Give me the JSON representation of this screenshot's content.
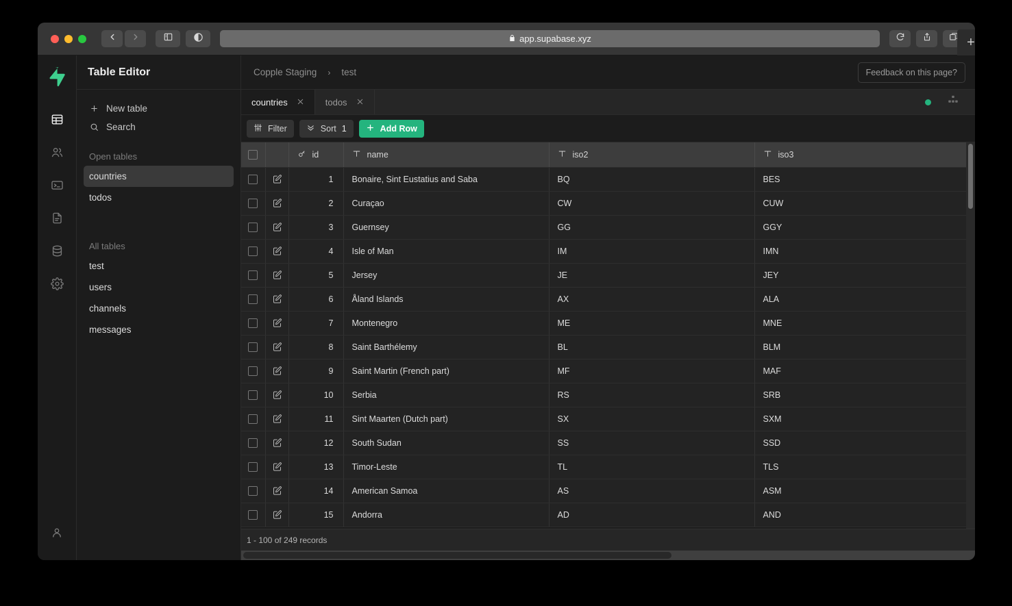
{
  "browser": {
    "url": "app.supabase.xyz",
    "lock_icon": "lock-icon",
    "back_icon": "back-arrow-icon",
    "forward_icon": "forward-arrow-icon",
    "sidebar_toggle_icon": "sidebar-toggle-icon",
    "reader_icon": "reader-mode-icon",
    "reload_icon": "reload-icon",
    "share_icon": "share-icon",
    "tabs_icon": "tab-overview-icon",
    "new_tab_label": "+"
  },
  "rail": {
    "logo_icon": "supabase-logo-icon",
    "items": [
      {
        "name": "table-editor",
        "icon": "table-icon",
        "active": true
      },
      {
        "name": "authentication",
        "icon": "users-icon",
        "active": false
      },
      {
        "name": "sql-editor",
        "icon": "terminal-icon",
        "active": false
      },
      {
        "name": "documentation",
        "icon": "file-icon",
        "active": false
      },
      {
        "name": "database",
        "icon": "database-icon",
        "active": false
      },
      {
        "name": "settings",
        "icon": "gear-icon",
        "active": false
      }
    ],
    "account_icon": "user-account-icon"
  },
  "panel": {
    "title": "Table Editor",
    "new_table_label": "New table",
    "new_table_icon": "plus-icon",
    "search_label": "Search",
    "search_icon": "search-icon",
    "open_tables_label": "Open tables",
    "open_tables": [
      {
        "label": "countries",
        "selected": true
      },
      {
        "label": "todos",
        "selected": false
      }
    ],
    "all_tables_label": "All tables",
    "all_tables": [
      {
        "label": "test"
      },
      {
        "label": "users"
      },
      {
        "label": "channels"
      },
      {
        "label": "messages"
      }
    ]
  },
  "topbar": {
    "breadcrumb_project": "Copple Staging",
    "breadcrumb_sep": "›",
    "breadcrumb_db": "test",
    "feedback_label": "Feedback on this page?"
  },
  "tabs": {
    "items": [
      {
        "label": "countries",
        "active": true,
        "close_icon": "close-icon"
      },
      {
        "label": "todos",
        "active": false,
        "close_icon": "close-icon"
      }
    ],
    "status_dot_color": "#24b47e",
    "schema_icon": "schema-visualizer-icon"
  },
  "toolbar": {
    "filter_label": "Filter",
    "filter_icon": "filter-sliders-icon",
    "sort_label": "Sort",
    "sort_icon": "sort-chevrons-icon",
    "sort_count": "1",
    "add_row_label": "Add Row",
    "add_row_icon": "plus-icon",
    "accent_color": "#24b47e"
  },
  "table": {
    "columns": [
      {
        "key": "id",
        "label": "id",
        "type_icon": "key-icon"
      },
      {
        "key": "name",
        "label": "name",
        "type_icon": "text-type-icon"
      },
      {
        "key": "iso2",
        "label": "iso2",
        "type_icon": "text-type-icon"
      },
      {
        "key": "iso3",
        "label": "iso3",
        "type_icon": "text-type-icon"
      }
    ],
    "select_all_icon": "checkbox-icon",
    "row_edit_icon": "edit-row-icon",
    "rows": [
      {
        "id": "1",
        "name": "Bonaire, Sint Eustatius and Saba",
        "iso2": "BQ",
        "iso3": "BES"
      },
      {
        "id": "2",
        "name": "Curaçao",
        "iso2": "CW",
        "iso3": "CUW"
      },
      {
        "id": "3",
        "name": "Guernsey",
        "iso2": "GG",
        "iso3": "GGY"
      },
      {
        "id": "4",
        "name": "Isle of Man",
        "iso2": "IM",
        "iso3": "IMN"
      },
      {
        "id": "5",
        "name": "Jersey",
        "iso2": "JE",
        "iso3": "JEY"
      },
      {
        "id": "6",
        "name": "Åland Islands",
        "iso2": "AX",
        "iso3": "ALA"
      },
      {
        "id": "7",
        "name": "Montenegro",
        "iso2": "ME",
        "iso3": "MNE"
      },
      {
        "id": "8",
        "name": "Saint Barthélemy",
        "iso2": "BL",
        "iso3": "BLM"
      },
      {
        "id": "9",
        "name": "Saint Martin (French part)",
        "iso2": "MF",
        "iso3": "MAF"
      },
      {
        "id": "10",
        "name": "Serbia",
        "iso2": "RS",
        "iso3": "SRB"
      },
      {
        "id": "11",
        "name": "Sint Maarten (Dutch part)",
        "iso2": "SX",
        "iso3": "SXM"
      },
      {
        "id": "12",
        "name": "South Sudan",
        "iso2": "SS",
        "iso3": "SSD"
      },
      {
        "id": "13",
        "name": "Timor-Leste",
        "iso2": "TL",
        "iso3": "TLS"
      },
      {
        "id": "14",
        "name": "American Samoa",
        "iso2": "AS",
        "iso3": "ASM"
      },
      {
        "id": "15",
        "name": "Andorra",
        "iso2": "AD",
        "iso3": "AND"
      }
    ]
  },
  "footer": {
    "records_label": "1 - 100 of 249 records"
  }
}
